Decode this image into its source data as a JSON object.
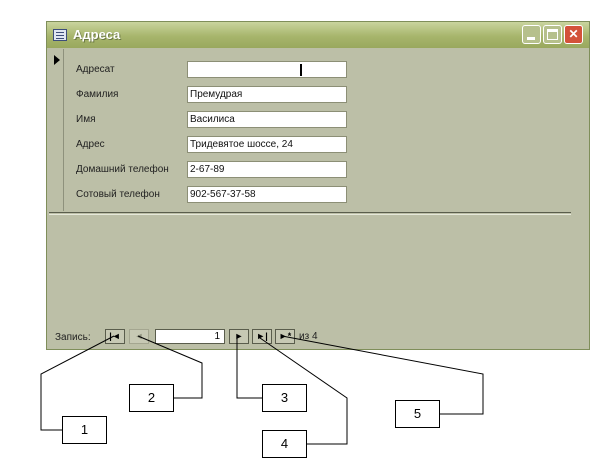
{
  "window": {
    "title": "Адреса"
  },
  "form": {
    "fields": [
      {
        "label": "Адресат",
        "value": ""
      },
      {
        "label": "Фамилия",
        "value": "Премудрая"
      },
      {
        "label": "Имя",
        "value": "Василиса"
      },
      {
        "label": "Адрес",
        "value": "Тридевятое шоссе, 24"
      },
      {
        "label": "Домашний телефон",
        "value": "2-67-89"
      },
      {
        "label": "Сотовый телефон",
        "value": "902-567-37-58"
      }
    ]
  },
  "navigation": {
    "label": "Запись:",
    "current_record": "1",
    "of_label": "из 4",
    "buttons": {
      "first": "|◄",
      "previous": "◄",
      "next": "►",
      "last": "►|",
      "new": "►*"
    }
  },
  "callouts": [
    "1",
    "2",
    "3",
    "4",
    "5"
  ]
}
